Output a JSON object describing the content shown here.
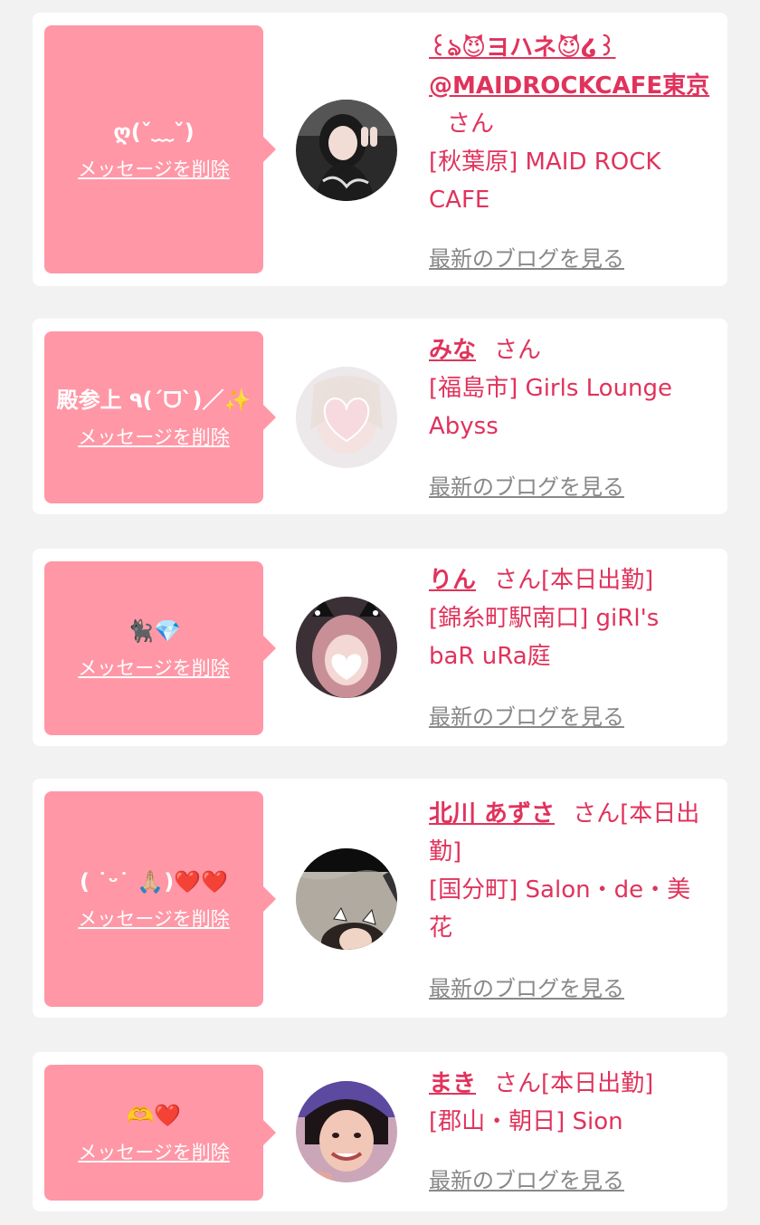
{
  "items": [
    {
      "message": "ღ(ˇ﹏ˇ)",
      "delete_label": "メッセージを削除",
      "name": "꒰ঌ😈ヨハネ😈໒꒱@MAIDROCKCAFE東京",
      "honorific": "さん",
      "status": "",
      "shop": "[秋葉原] MAID ROCK CAFE",
      "blog_label": "最新のブログを見る",
      "avatar_icon": "girl-peace-sign-photo"
    },
    {
      "message": "殿参上 ٩(ˊᗜˋ)／✨",
      "delete_label": "メッセージを削除",
      "name": "みな",
      "honorific": "さん",
      "status": "",
      "shop": "[福島市] Girls Lounge Abyss",
      "blog_label": "最新のブログを見る",
      "avatar_icon": "blurred-face-heart-sticker"
    },
    {
      "message": "🐈‍⬛💎",
      "delete_label": "メッセージを削除",
      "name": "りん",
      "honorific": "さん",
      "status": "[本日出勤]",
      "shop": "[錦糸町駅南口] giRl's baR uRa庭",
      "blog_label": "最新のブログを見る",
      "avatar_icon": "girl-cat-ears-heart-sticker"
    },
    {
      "message": "( ˙ᵕ˙ 🙏🏼)❤️❤️",
      "delete_label": "メッセージを削除",
      "name": "北川 あずさ",
      "honorific": "さん",
      "status": "[本日出勤]",
      "shop": "[国分町] Salon・de・美花",
      "blog_label": "最新のブログを見る",
      "avatar_icon": "girl-peeking-cat-ears"
    },
    {
      "message": "🫶❤️",
      "delete_label": "メッセージを削除",
      "name": "まき",
      "honorific": "さん",
      "status": "[本日出勤]",
      "shop": "[郡山・朝日] Sion",
      "blog_label": "最新のブログを見る",
      "avatar_icon": "girl-smiling-selfie"
    }
  ],
  "colors": {
    "bubble": "#ff97a6",
    "accent": "#e0335c",
    "link_gray": "#888888",
    "background": "#f2f2f2"
  }
}
